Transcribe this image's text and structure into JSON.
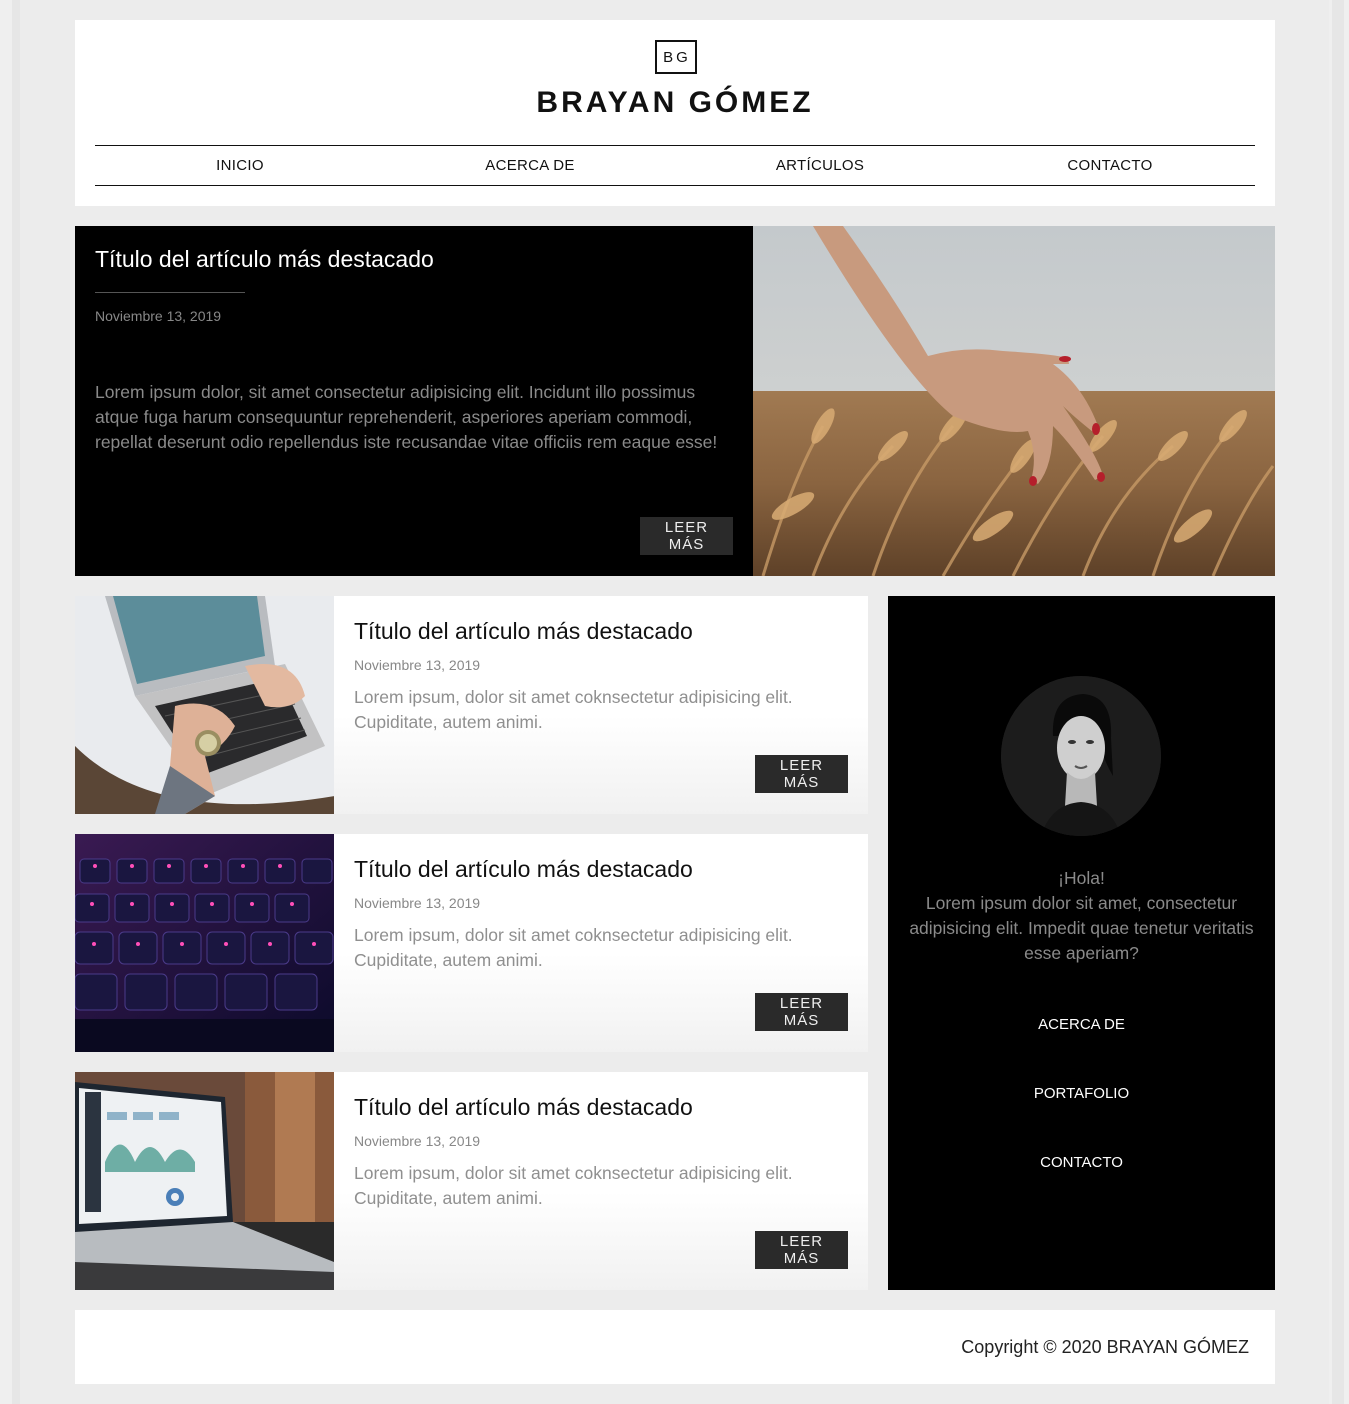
{
  "header": {
    "logo": "BG",
    "title": "BRAYAN GÓMEZ",
    "nav": [
      "INICIO",
      "ACERCA DE",
      "ARTÍCULOS",
      "CONTACTO"
    ]
  },
  "featured": {
    "title": "Título del artículo más destacado",
    "date": "Noviembre 13, 2019",
    "excerpt": "Lorem ipsum dolor, sit amet consectetur adipisicing elit. Incidunt illo possimus atque fuga harum consequuntur reprehenderit, asperiores aperiam commodi, repellat deserunt odio repellendus iste recusandae vitae officiis rem eaque esse!",
    "button": "LEER MÁS"
  },
  "articles": [
    {
      "title": "Título del artículo más destacado",
      "date": "Noviembre 13, 2019",
      "excerpt": "Lorem ipsum, dolor sit amet coknsectetur adipisicing elit. Cupiditate, autem animi.",
      "button": "LEER MÁS"
    },
    {
      "title": "Título del artículo más destacado",
      "date": "Noviembre 13, 2019",
      "excerpt": "Lorem ipsum, dolor sit amet coknsectetur adipisicing elit. Cupiditate, autem animi.",
      "button": "LEER MÁS"
    },
    {
      "title": "Título del artículo más destacado",
      "date": "Noviembre 13, 2019",
      "excerpt": "Lorem ipsum, dolor sit amet coknsectetur adipisicing elit. Cupiditate, autem animi.",
      "button": "LEER MÁS"
    }
  ],
  "sidebar": {
    "greeting": "¡Hola!",
    "about": "Lorem ipsum dolor sit amet, consectetur adipisicing elit. Impedit quae tenetur veritatis esse aperiam?",
    "links": [
      "ACERCA DE",
      "PORTAFOLIO",
      "CONTACTO"
    ]
  },
  "footer": {
    "copyright": "Copyright © 2020 BRAYAN GÓMEZ"
  },
  "colors": {
    "dark": "#000000",
    "button": "#2a2a2a",
    "muted_text": "#8a8a8a"
  }
}
